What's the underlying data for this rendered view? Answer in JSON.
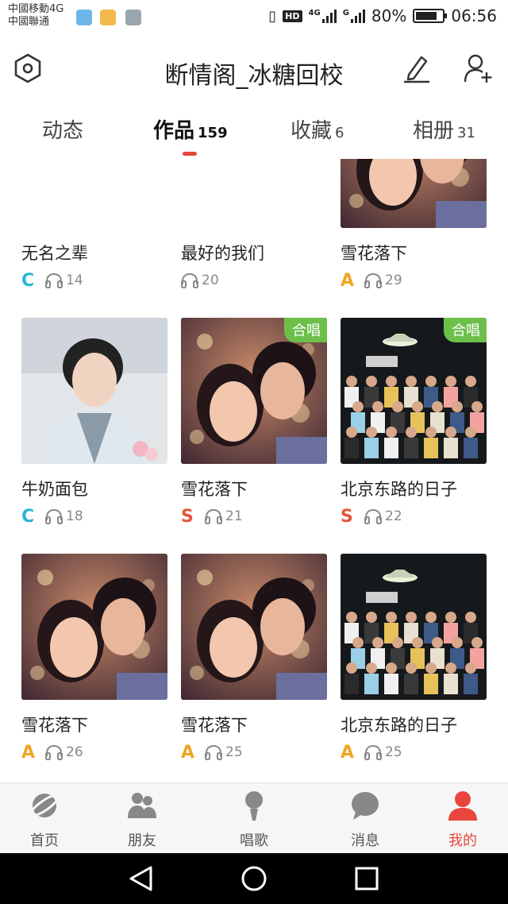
{
  "status_bar": {
    "carrier_1": "中國移動4G",
    "carrier_2": "中國聯通",
    "hd": "HD",
    "net_1": "4G",
    "net_2": "G",
    "battery": "80%",
    "battery_level": 0.8,
    "time": "06:56"
  },
  "header": {
    "title": "断情阁_冰糖回校",
    "settings_icon": "hexagon-gear-icon",
    "edit_icon": "pencil-icon",
    "add_friend_icon": "add-user-icon"
  },
  "tabs": [
    {
      "label": "动态",
      "count": ""
    },
    {
      "label": "作品",
      "count": "159",
      "active": true
    },
    {
      "label": "收藏",
      "count": "6"
    },
    {
      "label": "相册",
      "count": "31"
    }
  ],
  "works": [
    {
      "title": "无名之辈",
      "grade": "C",
      "plays": "14",
      "badge": "",
      "art": "cartoon"
    },
    {
      "title": "最好的我们",
      "grade": "",
      "plays": "20",
      "badge": "",
      "art": "sketch"
    },
    {
      "title": "雪花落下",
      "grade": "A",
      "plays": "29",
      "badge": "",
      "art": "couple"
    },
    {
      "title": "牛奶面包",
      "grade": "C",
      "plays": "18",
      "badge": "",
      "art": "portrait"
    },
    {
      "title": "雪花落下",
      "grade": "S",
      "plays": "21",
      "badge": "合唱",
      "art": "couple"
    },
    {
      "title": "北京东路的日子",
      "grade": "S",
      "plays": "22",
      "badge": "合唱",
      "art": "group"
    },
    {
      "title": "雪花落下",
      "grade": "A",
      "plays": "26",
      "badge": "",
      "art": "couple"
    },
    {
      "title": "雪花落下",
      "grade": "A",
      "plays": "25",
      "badge": "",
      "art": "couple"
    },
    {
      "title": "北京东路的日子",
      "grade": "A",
      "plays": "25",
      "badge": "",
      "art": "group"
    }
  ],
  "bottom_nav": [
    {
      "label": "首页",
      "icon": "planet-icon"
    },
    {
      "label": "朋友",
      "icon": "friends-icon"
    },
    {
      "label": "唱歌",
      "icon": "microphone-icon"
    },
    {
      "label": "消息",
      "icon": "chat-bubble-icon"
    },
    {
      "label": "我的",
      "icon": "person-icon",
      "active": true
    }
  ],
  "colors": {
    "accent": "#e8453c",
    "badge": "#6cc04a",
    "grade_C": "#2bb5d8",
    "grade_A": "#f1a523",
    "grade_S": "#e4563a"
  }
}
